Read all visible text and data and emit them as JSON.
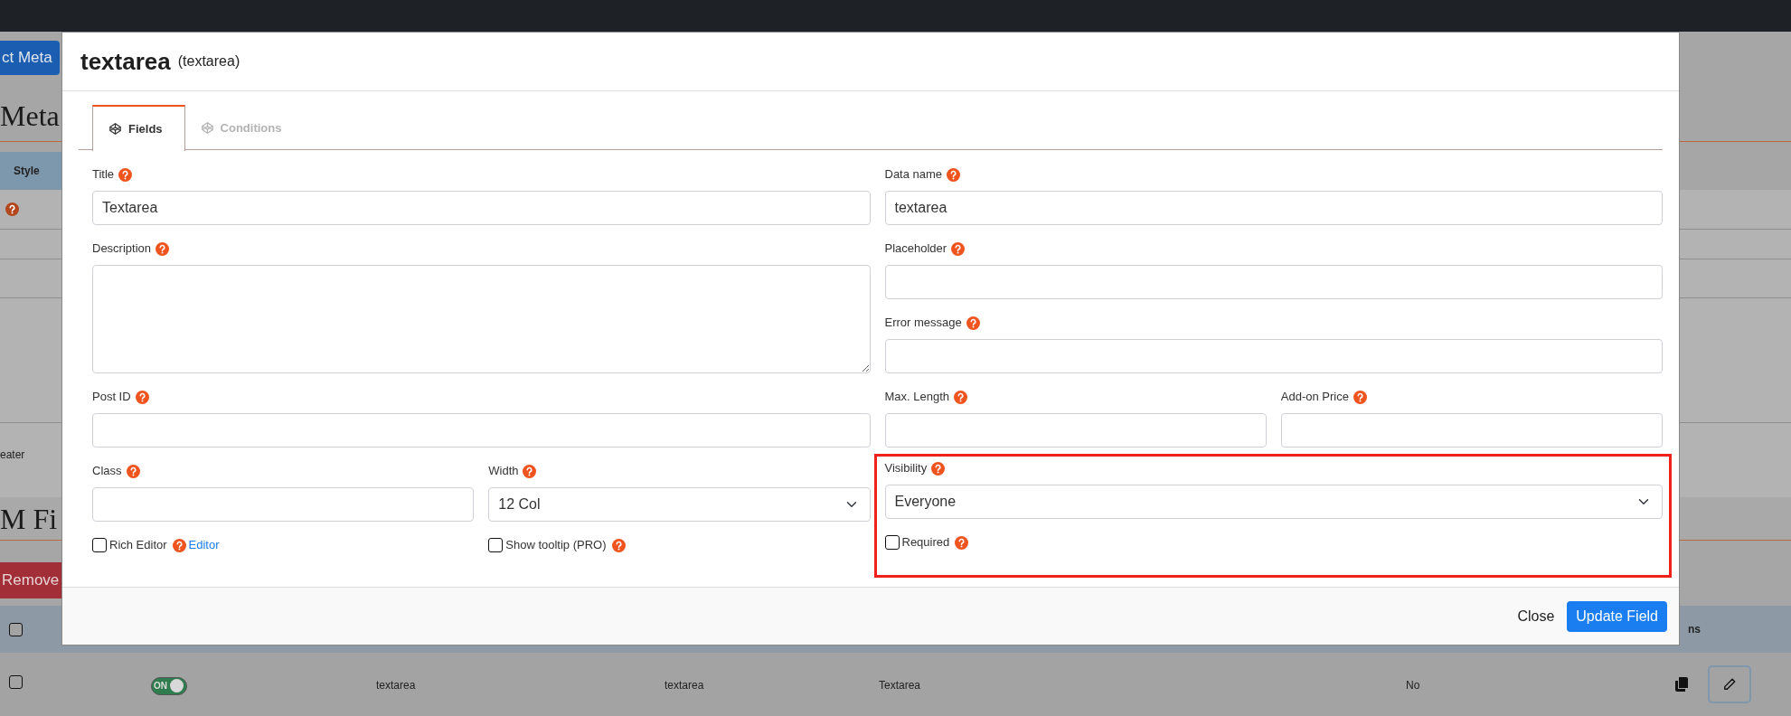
{
  "background_page": {
    "top_button": "ct Meta",
    "heading_1": "Meta",
    "table_1": {
      "column_header": "Style",
      "help_icon": true
    },
    "row_text": "eater",
    "heading_2": "M Fi",
    "remove_button": "Remove",
    "table_2": {
      "header_checkbox": {
        "checked": false
      },
      "column_header": "ns",
      "rows": [
        {
          "checked": false,
          "toggle": {
            "on": true,
            "label": "ON"
          },
          "cells": [
            "textarea",
            "textarea",
            "Textarea",
            "No"
          ]
        }
      ]
    }
  },
  "modal": {
    "title": "textarea",
    "subtitle": "(textarea)",
    "tabs": [
      {
        "label": "Fields",
        "selected": true
      },
      {
        "label": "Conditions",
        "selected": false
      }
    ],
    "left_column": [
      {
        "kind": "text",
        "label": "Title",
        "help": true,
        "value": "Textarea"
      },
      {
        "kind": "textarea",
        "label": "Description",
        "help": true
      },
      {
        "kind": "text",
        "label": "Post ID",
        "help": true
      },
      {
        "kind": "pair",
        "items": [
          {
            "kind": "text",
            "label": "Class",
            "help": true
          },
          {
            "kind": "select",
            "label": "Width",
            "help": true,
            "value": "12 Col"
          }
        ]
      },
      {
        "kind": "pair",
        "items": [
          {
            "kind": "checkbox",
            "label": "Rich Editor",
            "help": true,
            "checked": false,
            "link": "Editor"
          },
          {
            "kind": "checkbox",
            "label": "Show tooltip (PRO)",
            "help": true,
            "checked": false
          }
        ]
      }
    ],
    "right_column": [
      {
        "kind": "text",
        "label": "Data name",
        "help": true,
        "value": "textarea"
      },
      {
        "kind": "text",
        "label": "Placeholder",
        "help": true
      },
      {
        "kind": "text",
        "label": "Error message",
        "help": true
      },
      {
        "kind": "pair",
        "items": [
          {
            "kind": "text",
            "label": "Max. Length",
            "help": true
          },
          {
            "kind": "text",
            "label": "Add-on Price",
            "help": true
          }
        ]
      },
      {
        "kind": "highlight",
        "items": [
          {
            "kind": "select",
            "label": "Visibility",
            "help": true,
            "value": "Everyone"
          },
          {
            "kind": "checkbox",
            "label": "Required",
            "help": true,
            "checked": false
          }
        ]
      }
    ],
    "buttons": [
      {
        "kind": "link",
        "label": "Close"
      },
      {
        "kind": "primary",
        "label": "Update Field"
      }
    ]
  }
}
